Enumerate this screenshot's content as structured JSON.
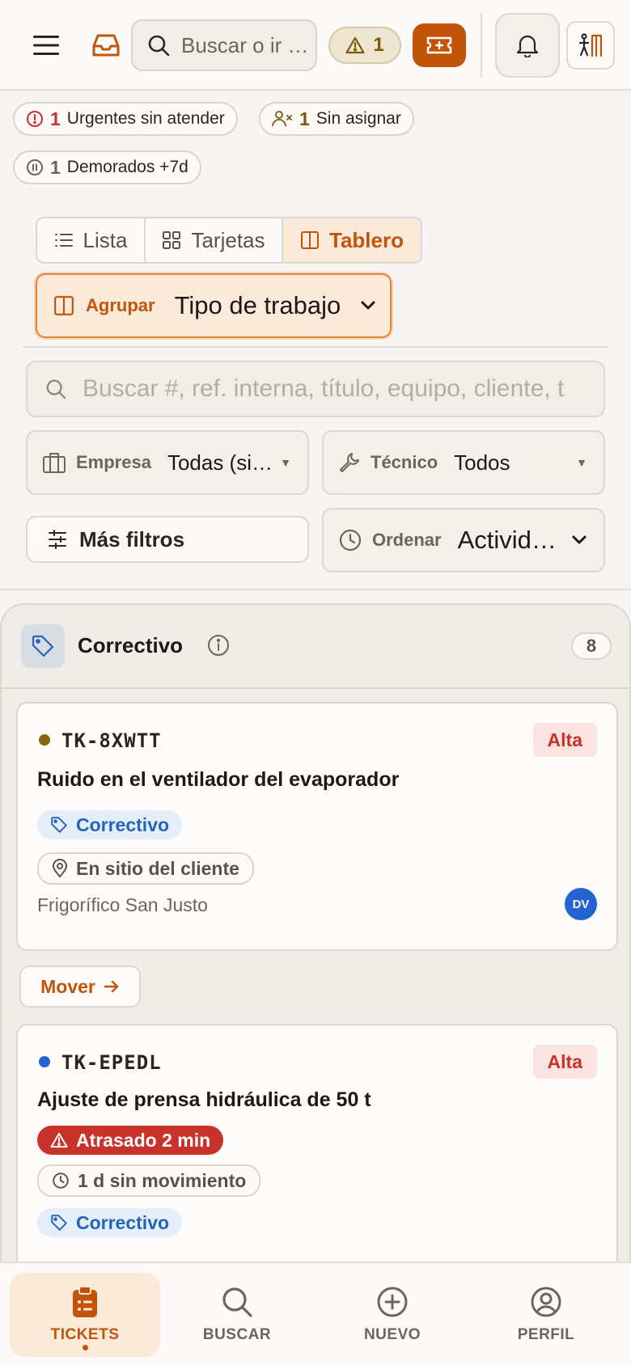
{
  "topbar": {
    "search_placeholder": "Buscar o ir …",
    "alert_count": "1"
  },
  "chips": [
    {
      "count": "1",
      "label": "Urgentes sin atender",
      "color": "#c8322b"
    },
    {
      "count": "1",
      "label": "Sin asignar",
      "color": "#7a5a0a"
    },
    {
      "count": "1",
      "label": "Demorados +7d",
      "color": "#6b6560"
    }
  ],
  "view_toggle": {
    "list": "Lista",
    "cards": "Tarjetas",
    "board": "Tablero",
    "active": "board"
  },
  "group": {
    "label": "Agrupar",
    "value": "Tipo de trabajo"
  },
  "filters": {
    "search_placeholder": "Buscar #, ref. interna, título, equipo, cliente, t",
    "company_label": "Empresa",
    "company_value": "Todas (si…",
    "tech_label": "Técnico",
    "tech_value": "Todos",
    "more": "Más filtros",
    "sort_label": "Ordenar",
    "sort_value": "Activid…"
  },
  "column": {
    "title": "Correctivo",
    "count": "8",
    "cards": [
      {
        "code": "TK-8XWTT",
        "dot_color": "#8a6516",
        "priority": "Alta",
        "title": "Ruido en el ventilador del evaporador",
        "type_tag": "Correctivo",
        "location": "En sitio del cliente",
        "client": "Frigorífico San Justo",
        "avatar": "DV"
      },
      {
        "code": "TK-EPEDL",
        "dot_color": "#2563d1",
        "priority": "Alta",
        "title": "Ajuste de prensa hidráulica de 50 t",
        "delay": "Atrasado 2 min",
        "stale": "1 d sin movimiento",
        "type_tag": "Correctivo"
      }
    ],
    "move_label": "Mover"
  },
  "nav": {
    "tickets": "TICKETS",
    "search": "BUSCAR",
    "new": "NUEVO",
    "profile": "PERFIL"
  },
  "colors": {
    "accent": "#c2540a",
    "danger": "#c8322b",
    "info": "#2563b7"
  }
}
